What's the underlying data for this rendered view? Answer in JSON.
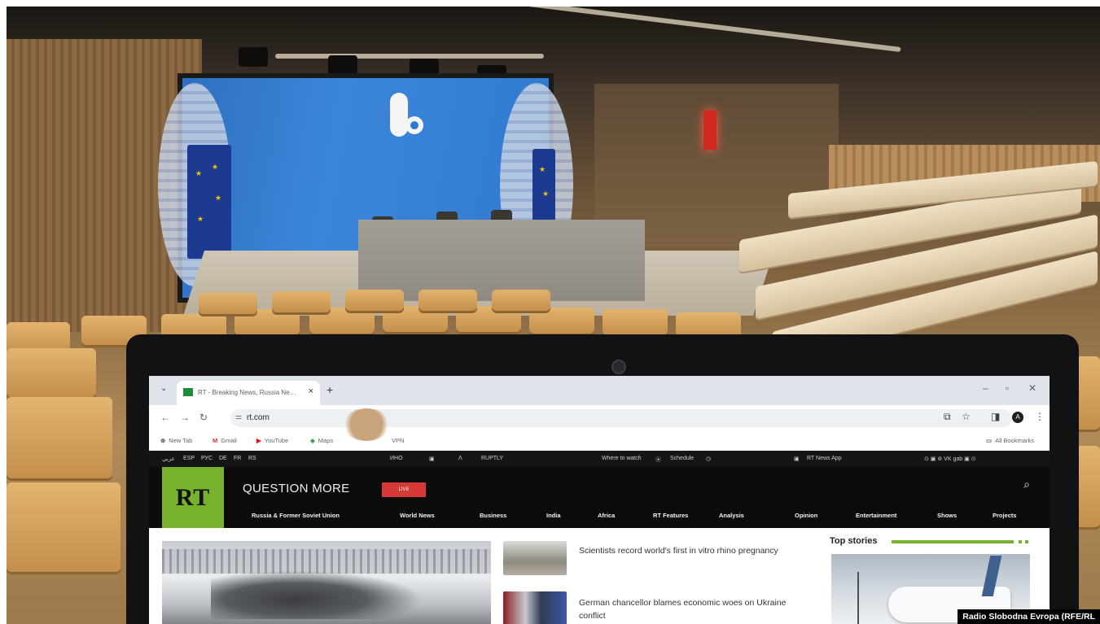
{
  "browser": {
    "tab_title": "RT - Breaking News, Russia Ne…",
    "tab_close": "×",
    "new_tab": "+",
    "url": "rt.com",
    "bookmarks": [
      {
        "icon": "globe-icon",
        "label": "New Tab"
      },
      {
        "icon": "gmail-icon",
        "label": "Gmail"
      },
      {
        "icon": "youtube-icon",
        "label": "YouTube"
      },
      {
        "icon": "maps-icon",
        "label": "Maps"
      },
      {
        "icon": "vpn-icon",
        "label": "VPN"
      }
    ],
    "all_bookmarks": "All Bookmarks"
  },
  "site": {
    "languages": [
      "عربي",
      "ESP",
      "РУС",
      "DE",
      "FR",
      "RS"
    ],
    "top_links": {
      "inosmi": "ИНО",
      "ruptly": "RUPTLY",
      "where_to_watch": "Where to watch",
      "schedule": "Schedule",
      "news_app": "RT News App"
    },
    "logo": "RT",
    "tagline": "QUESTION MORE",
    "live": "LIVE",
    "nav": [
      "Russia & Former Soviet Union",
      "World News",
      "Business",
      "India",
      "Africa",
      "RT Features",
      "Analysis",
      "Opinion",
      "Entertainment",
      "Shows",
      "Projects"
    ],
    "headlines": [
      "Scientists record world's first in vitro rhino pregnancy",
      "German chancellor blames economic woes on Ukraine conflict"
    ],
    "top_stories": "Top stories"
  },
  "credit": "Radio Slobodna Evropa (RFE/RL",
  "colors": {
    "rt_green": "#77b12e",
    "live_red": "#d63a36",
    "screen_blue": "#3b86da",
    "seat_wood": "#e2b46e"
  }
}
